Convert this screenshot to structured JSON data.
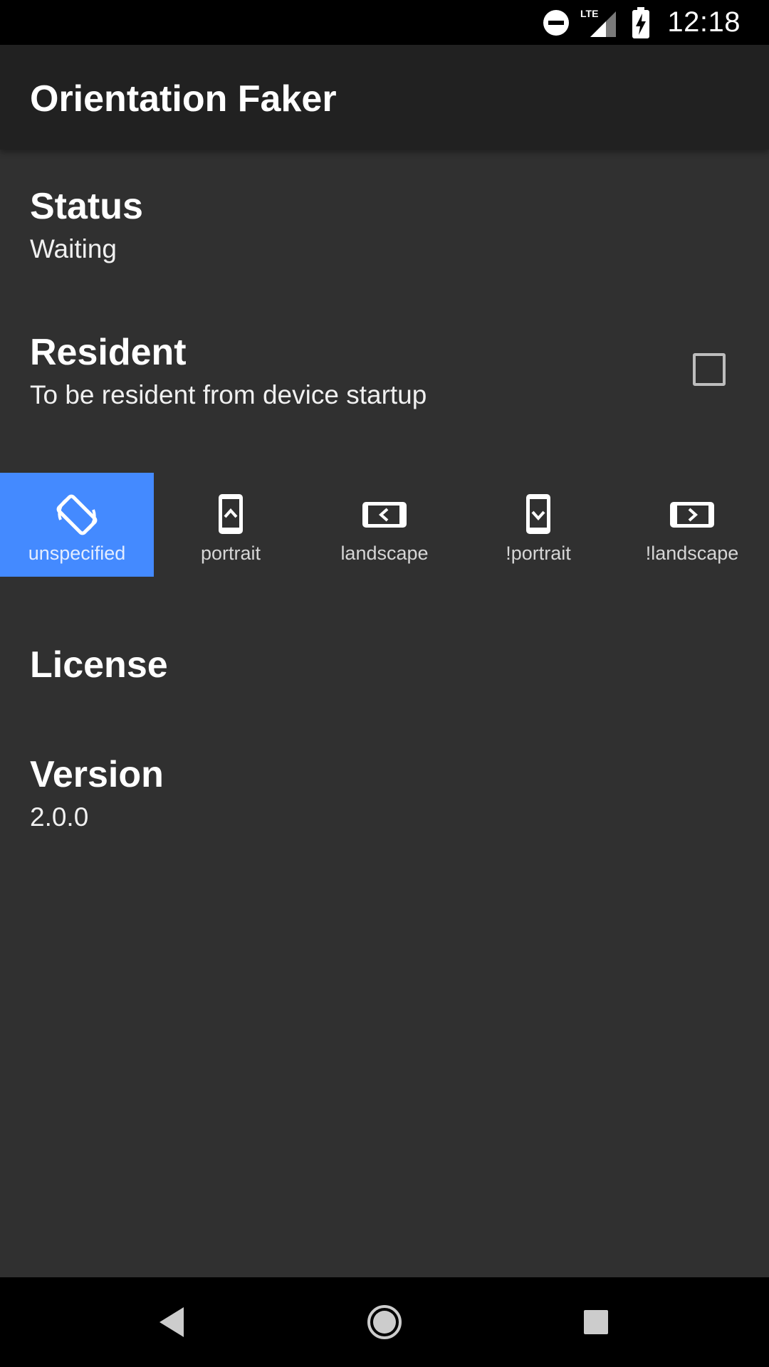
{
  "status_bar": {
    "time": "12:18",
    "network_label": "LTE",
    "icons": [
      "do-not-disturb-icon",
      "signal-icon",
      "battery-charging-icon"
    ]
  },
  "app_bar": {
    "title": "Orientation Faker"
  },
  "preferences": {
    "status": {
      "title": "Status",
      "summary": "Waiting"
    },
    "resident": {
      "title": "Resident",
      "summary": "To be resident from device startup",
      "checked": false
    },
    "license": {
      "title": "License"
    },
    "version": {
      "title": "Version",
      "summary": "2.0.0"
    }
  },
  "orientations": {
    "selected": "unspecified",
    "items": [
      {
        "label": "unspecified",
        "icon": "screen-rotation-icon"
      },
      {
        "label": "portrait",
        "icon": "portrait-phone-icon"
      },
      {
        "label": "landscape",
        "icon": "landscape-phone-icon"
      },
      {
        "label": "!portrait",
        "icon": "reverse-portrait-phone-icon"
      },
      {
        "label": "!landscape",
        "icon": "reverse-landscape-phone-icon"
      }
    ]
  },
  "nav_bar": {
    "buttons": [
      "back-icon",
      "home-icon",
      "recents-icon"
    ]
  },
  "colors": {
    "background": "#303030",
    "app_bar": "#212121",
    "accent": "#448aff",
    "system_bars": "#000000"
  }
}
